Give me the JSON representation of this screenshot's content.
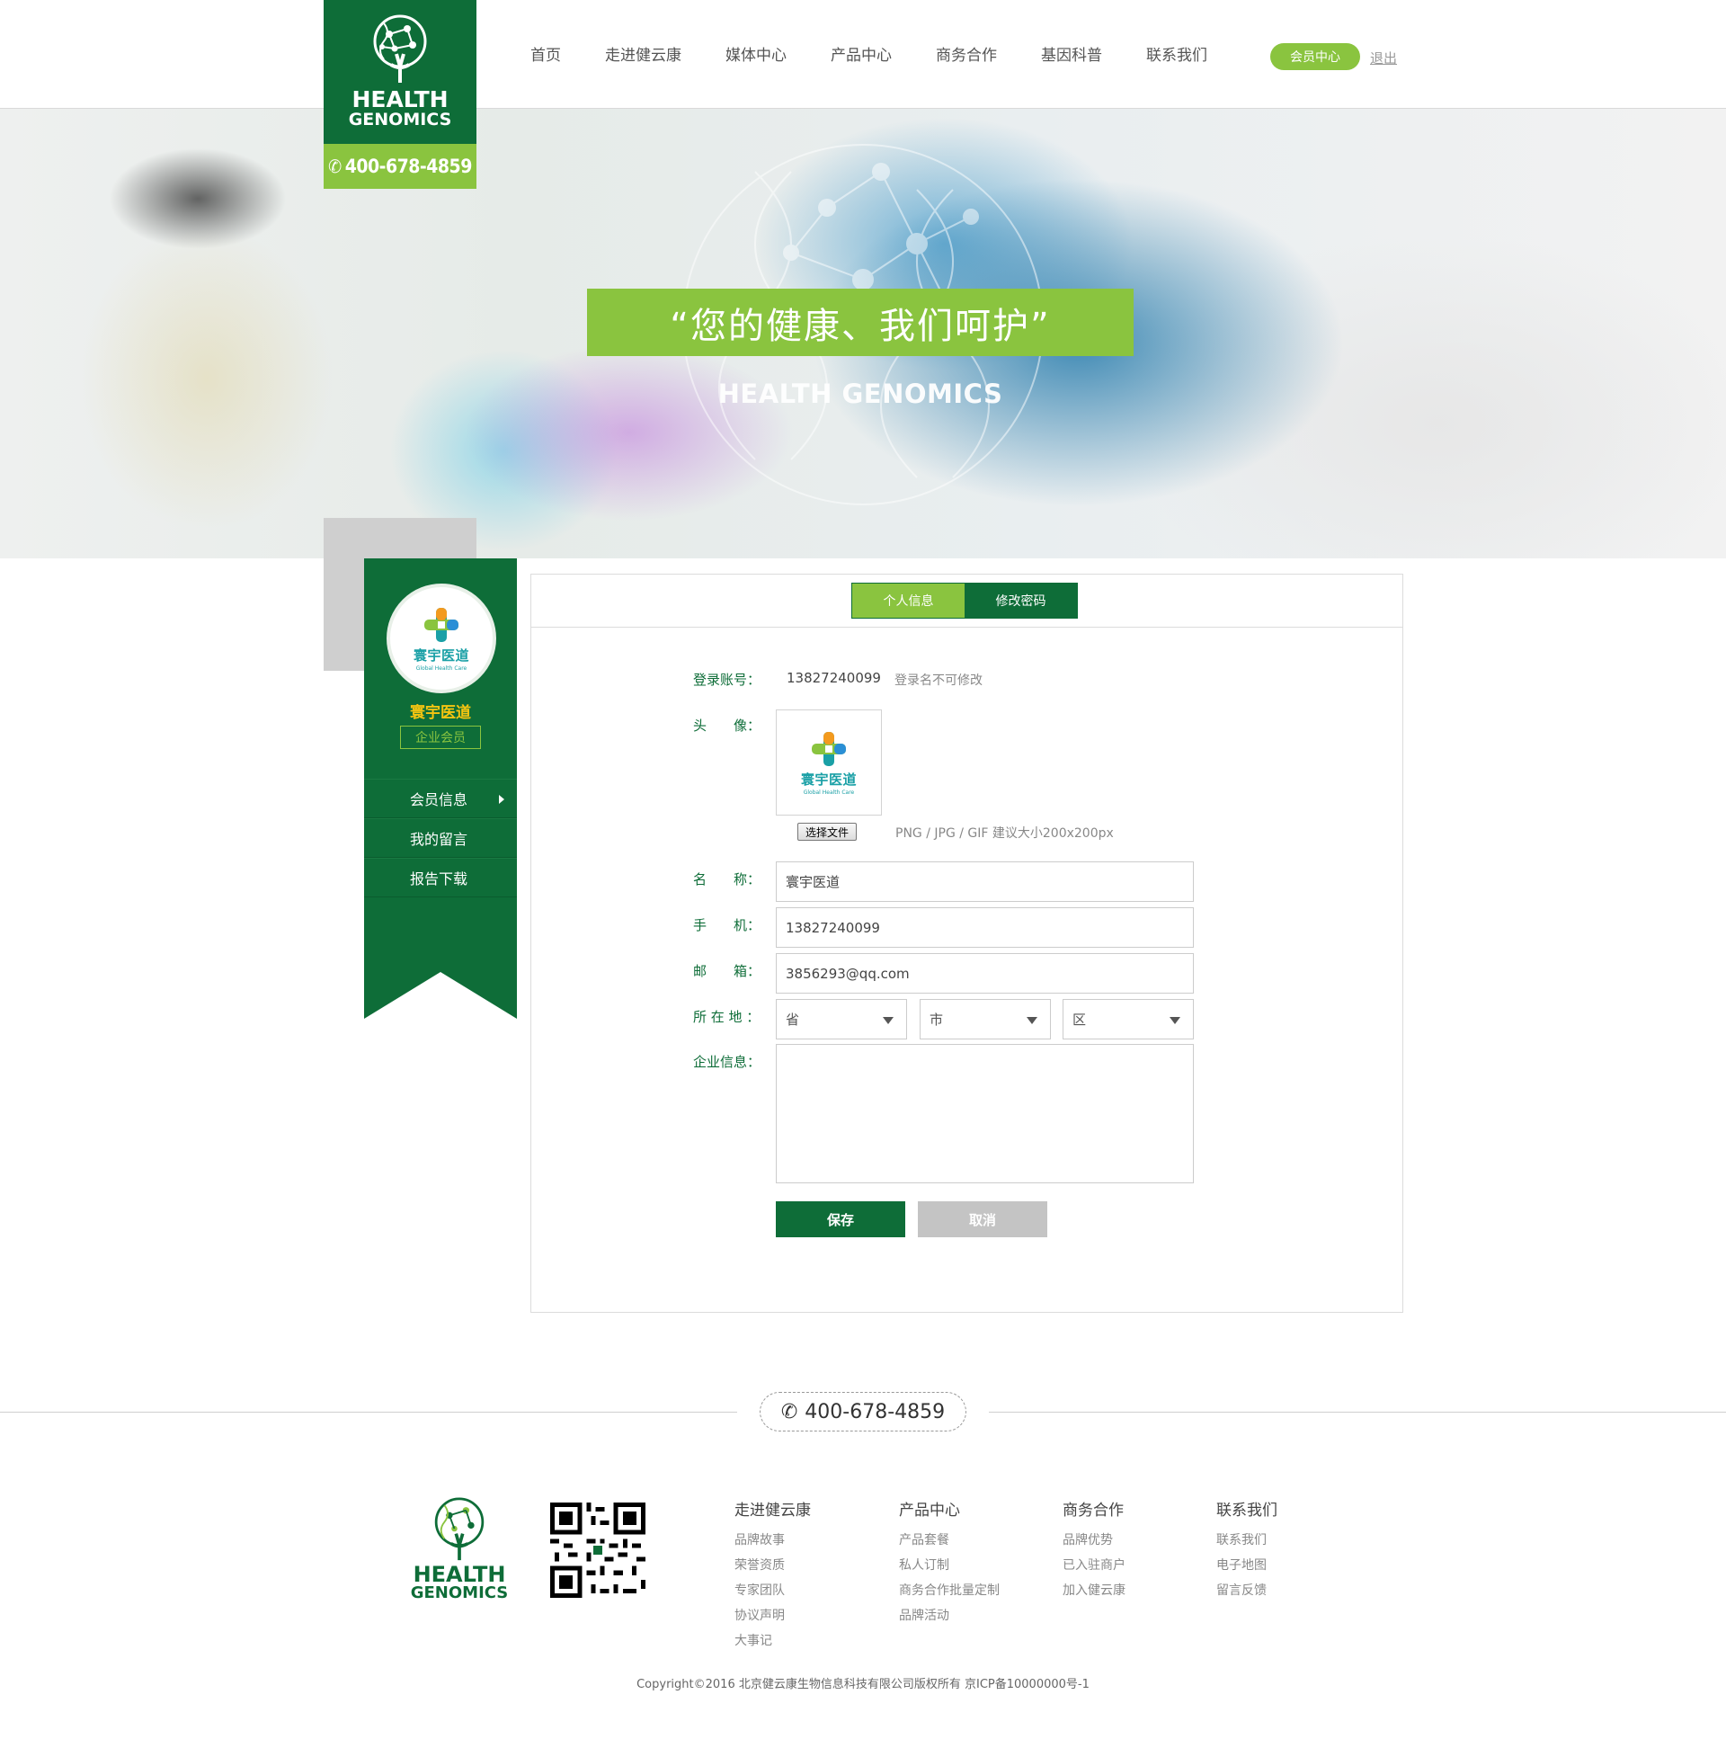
{
  "header": {
    "logo": {
      "line1": "HEALTH",
      "line2": "GENOMICS",
      "phone": "400-678-4859"
    },
    "nav": [
      "首页",
      "走进健云康",
      "媒体中心",
      "产品中心",
      "商务合作",
      "基因科普",
      "联系我们"
    ],
    "member_center": "会员中心",
    "logout": "退出"
  },
  "banner": {
    "slogan": "“您的健康、我们呵护”",
    "subtitle": "HEALTH GENOMICS"
  },
  "sidebar": {
    "brand_cn": "寰宇医道",
    "brand_en": "Global Health Care",
    "name": "寰宇医道",
    "badge": "企业会员",
    "menu": [
      "会员信息",
      "我的留言",
      "报告下载"
    ]
  },
  "panel": {
    "tabs": [
      "个人信息",
      "修改密码"
    ],
    "fields": {
      "account_label": "登录账号：",
      "account_value": "13827240099",
      "account_hint": "登录名不可修改",
      "avatar_label": "头　　像：",
      "file_button": "选择文件",
      "file_hint": "PNG / JPG / GIF  建议大小200x200px",
      "name_label": "名　　称：",
      "name_value": "寰宇医道",
      "phone_label": "手　　机：",
      "phone_value": "13827240099",
      "email_label": "邮　　箱：",
      "email_value": "3856293@qq.com",
      "location_label": "所 在 地 ：",
      "province": "省",
      "city": "市",
      "district": "区",
      "company_label": "企业信息："
    },
    "save": "保存",
    "cancel": "取消"
  },
  "footer": {
    "phone": "400-678-4859",
    "logo": {
      "line1": "HEALTH",
      "line2": "GENOMICS"
    },
    "columns": [
      {
        "title": "走进健云康",
        "links": [
          "品牌故事",
          "荣誉资质",
          "专家团队",
          "协议声明",
          "大事记"
        ]
      },
      {
        "title": "产品中心",
        "links": [
          "产品套餐",
          "私人订制",
          "商务合作批量定制",
          "品牌活动"
        ]
      },
      {
        "title": "商务合作",
        "links": [
          "品牌优势",
          "已入驻商户",
          "加入健云康"
        ]
      },
      {
        "title": "联系我们",
        "links": [
          "联系我们",
          "电子地图",
          "留言反馈"
        ]
      }
    ],
    "copyright": "Copyright©2016 北京健云康生物信息科技有限公司版权所有  京ICP备10000000号-1"
  },
  "colors": {
    "dark_green": "#0e6d38",
    "light_green": "#8ac43f",
    "gold": "#f6c511",
    "teal": "#1aa0a6"
  },
  "icons": [
    "tree-logo-icon",
    "phone-icon",
    "caret-down-icon",
    "chevron-right-icon",
    "qr-code-icon"
  ]
}
